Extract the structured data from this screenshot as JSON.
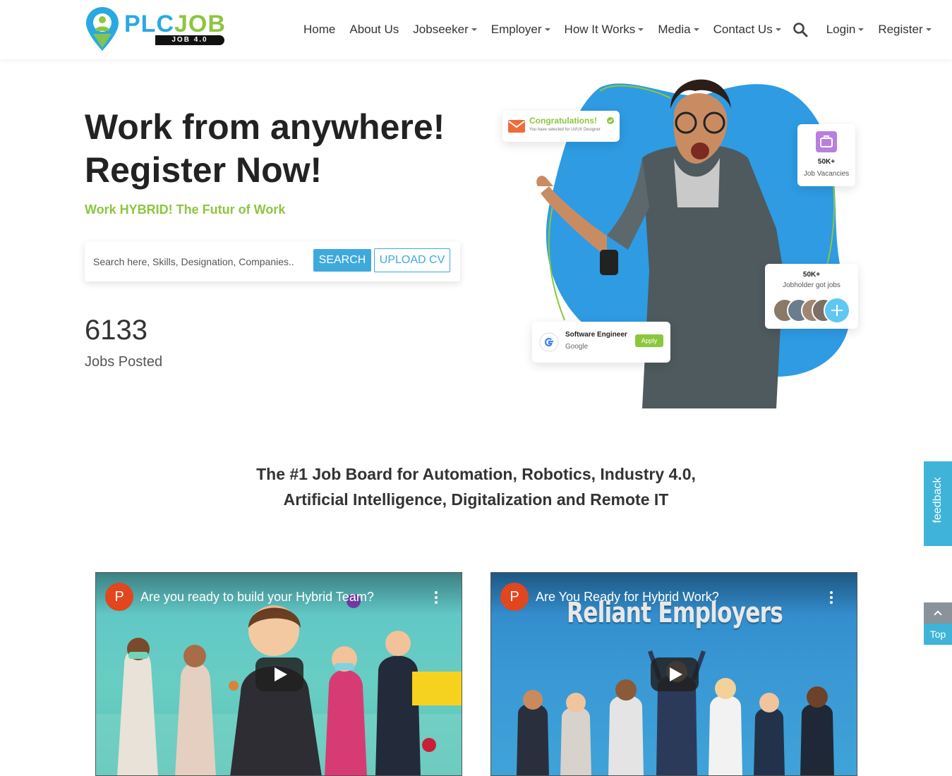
{
  "header": {
    "logo": {
      "part1": "PLC",
      "part2": "JOB",
      "badge": "JOB 4.0"
    },
    "nav": [
      {
        "label": "Home",
        "dropdown": false
      },
      {
        "label": "About Us",
        "dropdown": false
      },
      {
        "label": "Jobseeker",
        "dropdown": true
      },
      {
        "label": "Employer",
        "dropdown": true
      },
      {
        "label": "How It Works",
        "dropdown": true
      },
      {
        "label": "Media",
        "dropdown": true
      },
      {
        "label": "Contact Us",
        "dropdown": true
      }
    ],
    "search_icon": "search-icon",
    "account": [
      {
        "label": "Login",
        "dropdown": true
      },
      {
        "label": "Register",
        "dropdown": true
      }
    ]
  },
  "hero": {
    "title_line1": "Work from anywhere!",
    "title_line2": "Register Now!",
    "subtitle": "Work HYBRID! The Futur of Work",
    "search": {
      "placeholder": "Search here, Skills, Designation, Companies..",
      "search_button": "SEARCH",
      "upload_button": "UPLOAD CV"
    },
    "jobs_count": "6133",
    "jobs_label": "Jobs Posted",
    "cards": {
      "congrats_title": "Congratulations!",
      "congrats_sub": "You have selected for UI/UX Designer",
      "vacancies_num": "50K+",
      "vacancies_label": "Job Vacancies",
      "holders_num": "50K+",
      "holders_label": "Jobholder got jobs",
      "job_title": "Software Engineer",
      "job_company": "Google",
      "job_apply": "Apply"
    }
  },
  "tagline": {
    "line1": "The #1 Job Board for Automation, Robotics, Industry 4.0,",
    "line2": "Artificial Intelligence, Digitalization and Remote IT"
  },
  "videos": [
    {
      "channel_initial": "P",
      "title": "Are you ready to build your Hybrid Team?",
      "overlay": ""
    },
    {
      "channel_initial": "P",
      "title": "Are You Ready for Hybrid Work?",
      "overlay": "Reliant Employers"
    }
  ],
  "side": {
    "feedback": "feedback",
    "top": "Top"
  },
  "colors": {
    "brand_blue": "#29a9e1",
    "brand_green": "#8cc63f",
    "accent": "#3fa9dc"
  }
}
